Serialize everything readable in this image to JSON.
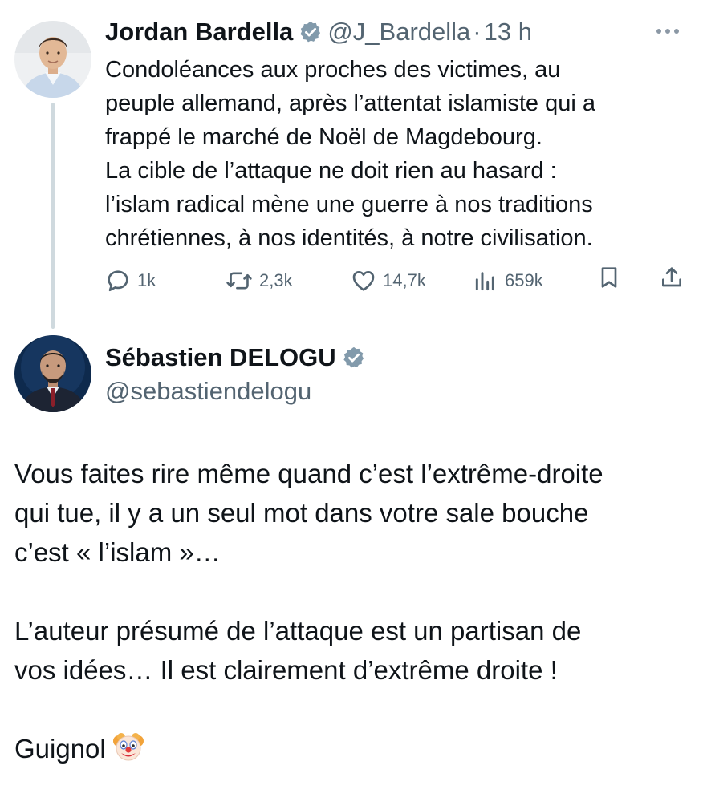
{
  "tweet": {
    "author": {
      "name": "Jordan Bardella",
      "handle": "@J_Bardella",
      "separator": "·",
      "time": "13 h",
      "verified": true
    },
    "more_icon": "more-dots-icon",
    "text_lines": [
      "Condoléances aux proches des victimes, au",
      "peuple allemand, après l’attentat islamiste qui a",
      "frappé le marché de Noël de Magdebourg.",
      "La cible de l’attaque ne doit rien au hasard :",
      "l’islam radical mène une guerre à nos traditions",
      "chrétiennes, à nos identités, à notre civilisation."
    ],
    "actions": {
      "replies": "1k",
      "retweets": "2,3k",
      "likes": "14,7k",
      "views": "659k"
    }
  },
  "reply": {
    "author": {
      "name": "Sébastien DELOGU",
      "handle": "@sebastiendelogu",
      "verified": true
    },
    "paragraphs": [
      [
        "Vous faites rire même quand c’est l’extrême-droite",
        "qui tue, il y a un seul mot dans votre sale bouche",
        "c’est « l’islam »…"
      ],
      [
        "L’auteur présumé de l’attaque est un partisan de",
        "vos idées… Il est clairement d’extrême droite !"
      ]
    ],
    "closing": "Guignol",
    "closing_emoji": "clown-face-emoji"
  },
  "colors": {
    "text": "#0f1419",
    "secondary": "#536471",
    "thread_line": "#cfd9de",
    "verified_badge": "#829aab"
  }
}
